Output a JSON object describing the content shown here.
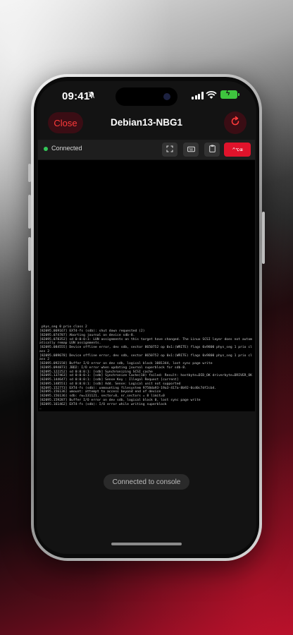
{
  "status_bar": {
    "time": "09:41",
    "battery_color": "#3ec43e"
  },
  "nav": {
    "close_label": "Close",
    "title": "Debian13-NBG1",
    "accent_color": "#ff3b3b"
  },
  "toolbar": {
    "connection_status": "Connected",
    "buttons": [
      {
        "name": "fullscreen-icon"
      },
      {
        "name": "keyboard-icon"
      },
      {
        "name": "clipboard-icon"
      }
    ],
    "ctrl_alt_del_label": "^⌥⌫"
  },
  "console": {
    "lines": [
      " phys_seg 0 prio class 2",
      "[82095.069167] EXT4-fs (sdb): shut down requested (2)",
      "[82095.074787] Aborting journal on device sdb-8.",
      "[82095.078352] sd 0:0:0:1: LUN assignments on this target have changed. The Linux SCSI layer does not automatically remap LUN assignments.",
      "[82095.084555] Device offline error, dev sdb, sector 8650752 op 0x1:(WRITE) flags 0x9800 phys_seg 1 prio class 2",
      "[82095.089678] Device offline error, dev sdb, sector 8650752 op 0x1:(WRITE) flags 0x9800 phys_seg 1 prio class 2",
      "[82095.092158] Buffer I/O error on dev sdb, logical block 1081344, lost sync page write",
      "[82095.094873] JBD2: I/O error when updating journal superblock for sdb-8.",
      "[82095.122252] sd 0:0:0:1: [sdb] Synchronizing SCSI cache",
      "[82095.137463] sd 0:0:0:1: [sdb] Synchronize Cache(10) failed: Result: hostbyte=DID_OK driverbyte=DRIVER_OK",
      "[82095.144647] sd 0:0:0:1: [sdb] Sense Key : Illegal Request [current]",
      "[82095.148551] sd 0:0:0:1: [sdb] Add. Sense: Logical unit not supported",
      "[82095.152773] EXT4-fs (sdb): unmounting filesystem 9758da93-19a3-417a-8b92-0cd0c7df2cb4.",
      "[82095.156136] umount: attempt to access beyond end of device",
      "[82095.156136] sdb: rw=131121, sector=0, nr_sectors = 8 limit=0",
      "[82095.159287] Buffer I/O error on dev sdb, logical block 0, lost sync page write",
      "[82095.161462] EXT4-fs (sdb): I/O error while writing superblock"
    ],
    "cursor": "_"
  },
  "toast": {
    "message": "Connected to console"
  }
}
